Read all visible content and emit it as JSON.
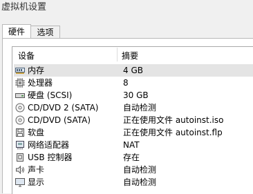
{
  "window_title": "虚拟机设置",
  "tabs": [
    {
      "label": "硬件"
    },
    {
      "label": "选项"
    }
  ],
  "columns": {
    "device": "设备",
    "summary": "摘要"
  },
  "devices": [
    {
      "icon": "memory-icon",
      "name": "内存",
      "summary": "4 GB"
    },
    {
      "icon": "processor-icon",
      "name": "处理器",
      "summary": "8"
    },
    {
      "icon": "hard-disk-icon",
      "name": "硬盘 (SCSI)",
      "summary": "30 GB"
    },
    {
      "icon": "cd-dvd-icon",
      "name": "CD/DVD 2 (SATA)",
      "summary": "自动检测"
    },
    {
      "icon": "cd-dvd-icon",
      "name": "CD/DVD (SATA)",
      "summary": "正在使用文件 autoinst.iso"
    },
    {
      "icon": "floppy-icon",
      "name": "软盘",
      "summary": "正在使用文件 autoinst.flp"
    },
    {
      "icon": "network-adapter-icon",
      "name": "网络适配器",
      "summary": "NAT"
    },
    {
      "icon": "usb-controller-icon",
      "name": "USB 控制器",
      "summary": "存在"
    },
    {
      "icon": "sound-card-icon",
      "name": "声卡",
      "summary": "自动检测"
    },
    {
      "icon": "display-icon",
      "name": "显示",
      "summary": "自动检测"
    }
  ]
}
